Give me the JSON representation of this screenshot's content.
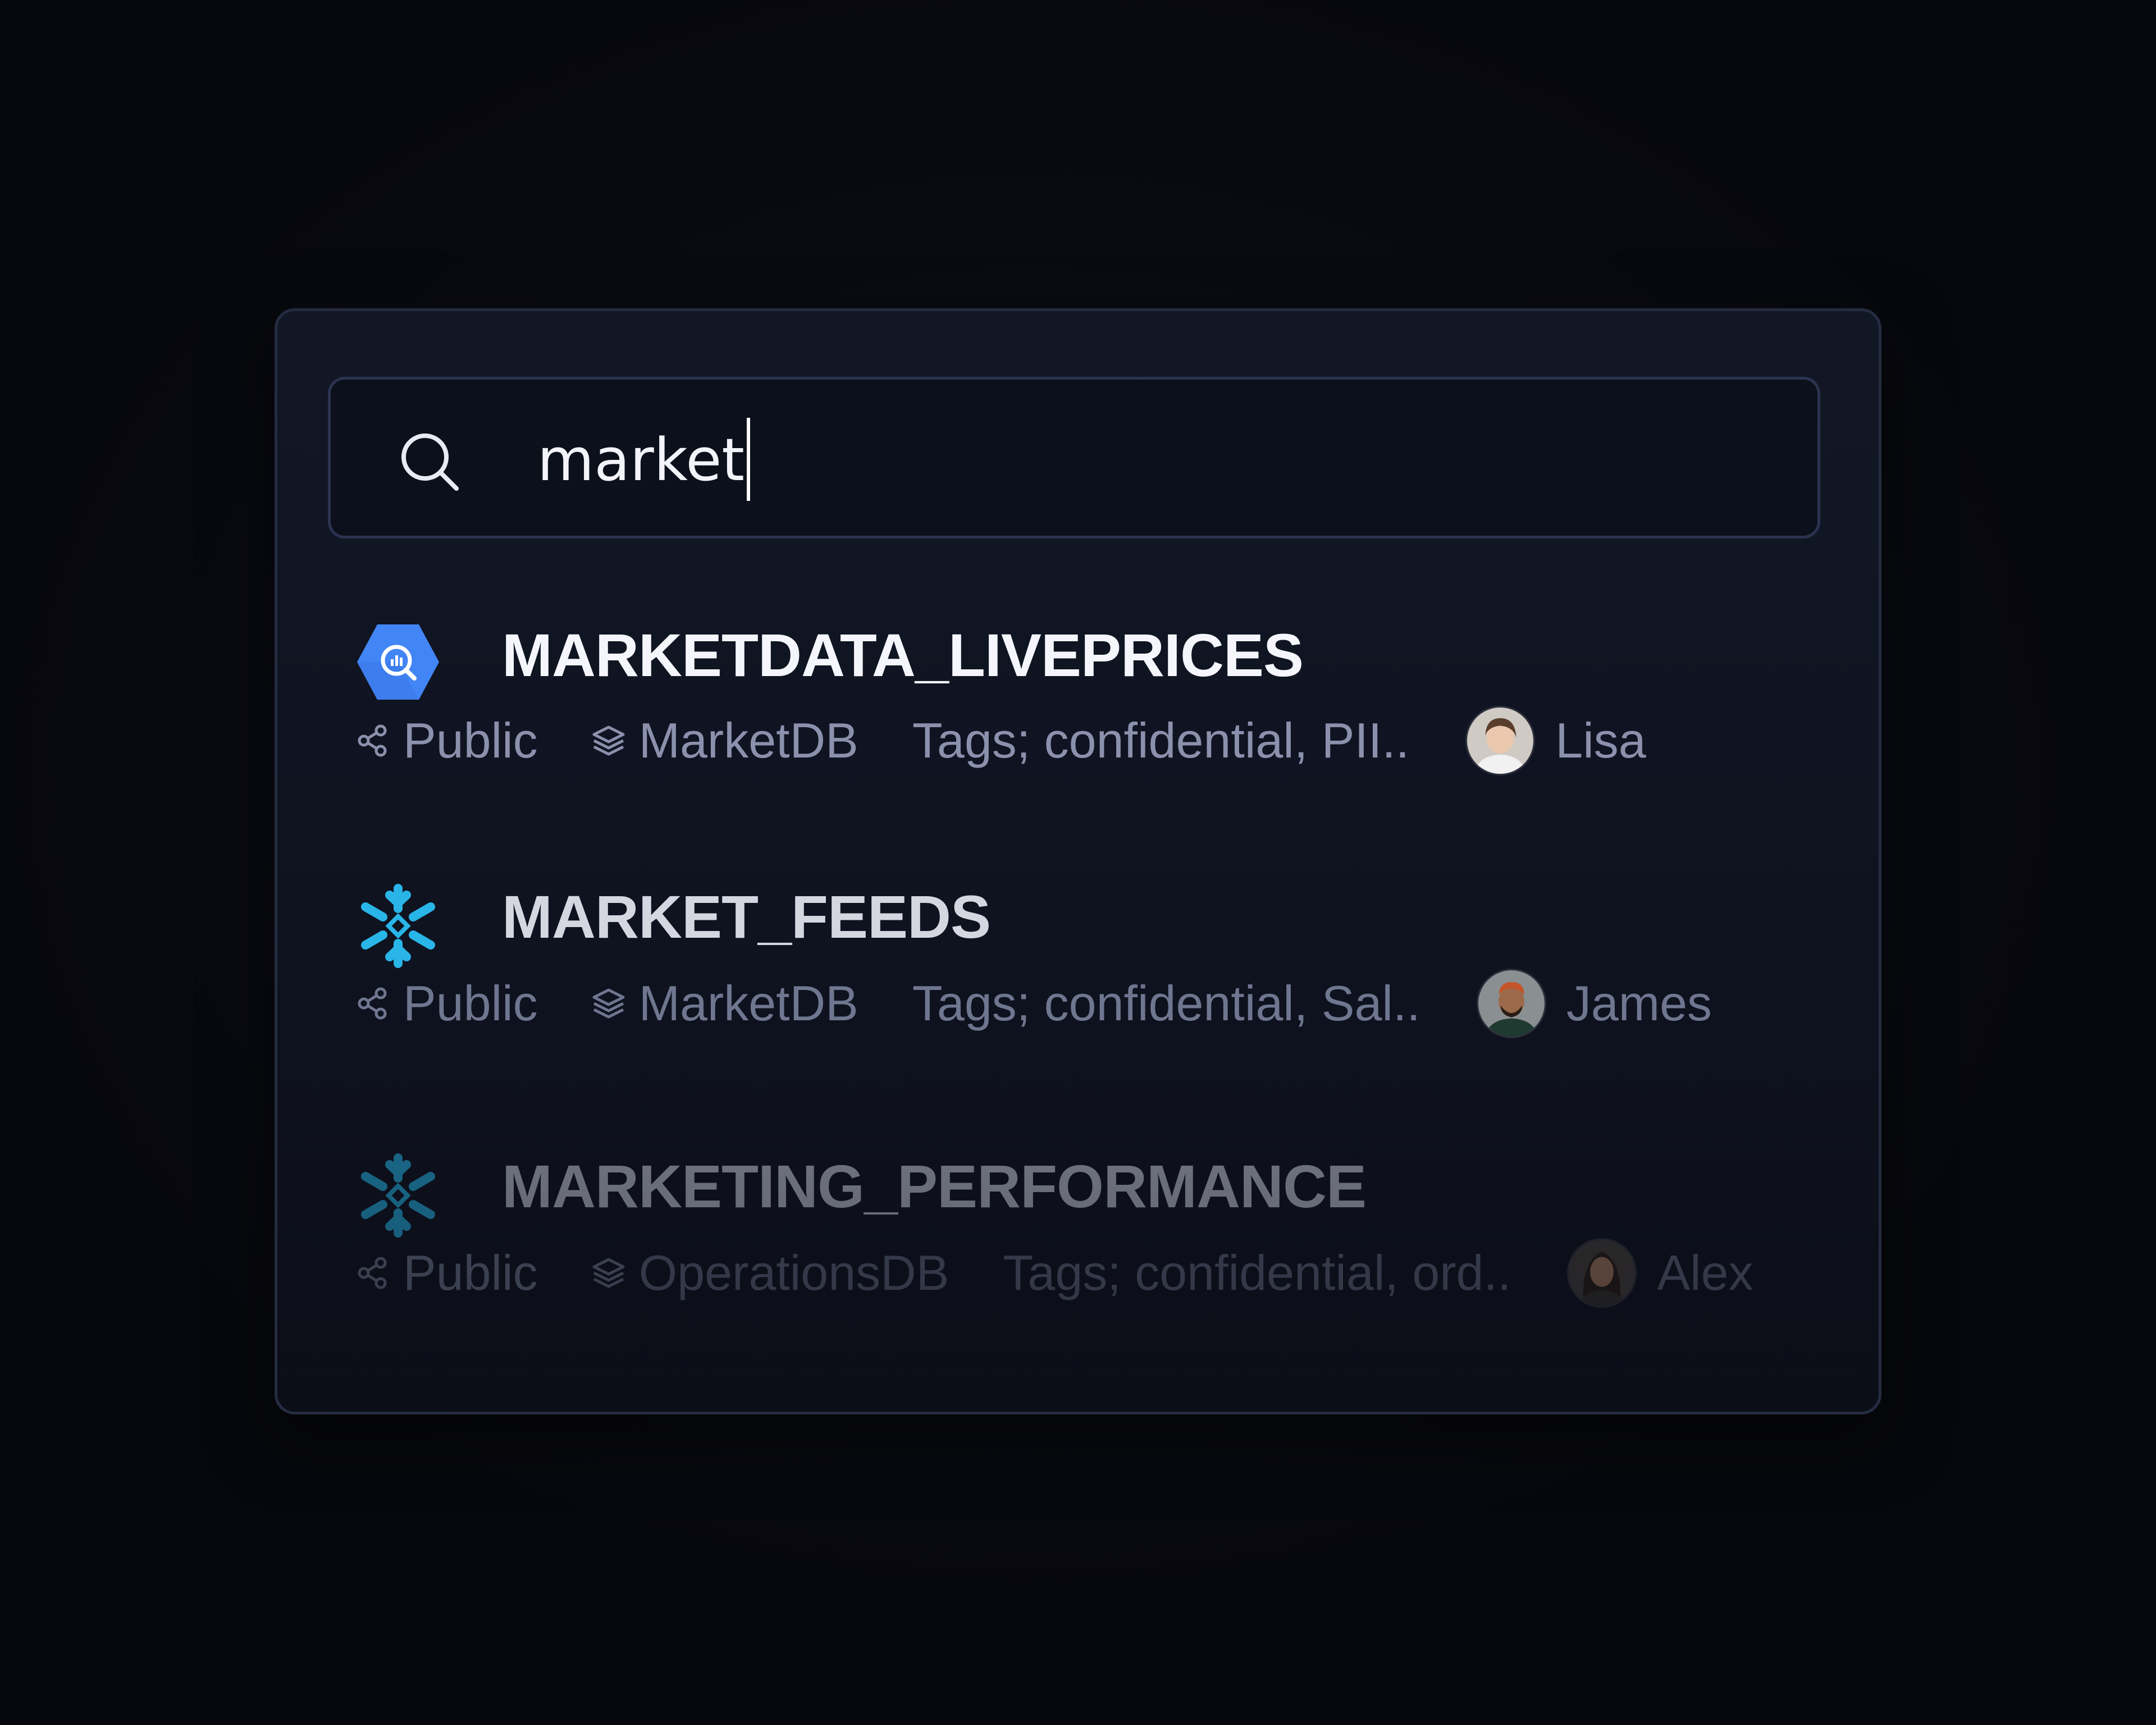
{
  "search": {
    "query": "market"
  },
  "results": [
    {
      "title": "MARKETDATA_LIVEPRICES",
      "logo": "bigquery-icon",
      "visibility": "Public",
      "database": "MarketDB",
      "tags": "Tags; confidential, PII..",
      "owner": "Lisa"
    },
    {
      "title": "MARKET_FEEDS",
      "logo": "snowflake-icon",
      "visibility": "Public",
      "database": "MarketDB",
      "tags": "Tags; confidential, Sal..",
      "owner": "James"
    },
    {
      "title": "MARKETING_PERFORMANCE",
      "logo": "snowflake-icon",
      "visibility": "Public",
      "database": "OperationsDB",
      "tags": "Tags; confidential, ord..",
      "owner": "Alex"
    }
  ],
  "colors": {
    "background": "#080a10",
    "panel": "#111624",
    "border": "#252c41",
    "bigquery_blue": "#4285f4",
    "snowflake_blue": "#29b5e8"
  }
}
